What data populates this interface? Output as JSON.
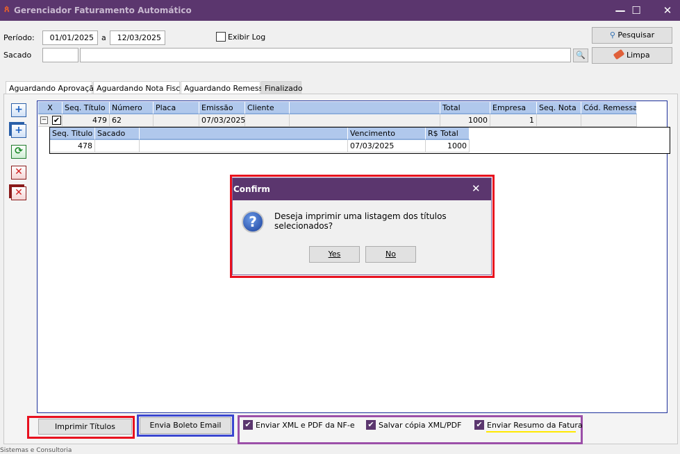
{
  "window": {
    "title": "Gerenciador Faturamento Automático",
    "minimize": "—",
    "maximize": "☐",
    "close": "✕"
  },
  "filters": {
    "periodo_label": "Período:",
    "date_from": "01/01/2025",
    "date_sep": "a",
    "date_to": "12/03/2025",
    "exibir_log_label": "Exibir Log",
    "sacado_label": "Sacado",
    "sacado_code": "",
    "sacado_name": ""
  },
  "buttons": {
    "pesquisar": "Pesquisar",
    "limpa": "Limpa",
    "imprimir": "Imprimir Títulos",
    "envia_boleto": "Envia Boleto Email"
  },
  "tabs": [
    "Aguardando Aprovação",
    "Aguardando Nota Fiscal",
    "Aguardando Remessa",
    "Finalizado"
  ],
  "grid": {
    "columns": [
      "X",
      "Seq. Título",
      "Número",
      "Placa",
      "Emissão",
      "Cliente",
      "",
      "Total",
      "Empresa",
      "Seq. Nota",
      "Cód. Remessa"
    ],
    "rows": [
      {
        "expand": "−",
        "checked": true,
        "seq": "479",
        "numero": "62",
        "placa": "",
        "emissao": "07/03/2025",
        "cliente": "",
        "blank": "",
        "total": "1000",
        "empresa": "1",
        "seq_nota": "",
        "cod_remessa": ""
      }
    ],
    "detail": {
      "columns": [
        "Seq. Titulo",
        "Sacado",
        "",
        "Vencimento",
        "R$ Total"
      ],
      "rows": [
        {
          "seq": "478",
          "sacado": "",
          "blank": "",
          "vencimento": "07/03/2025",
          "total": "1000"
        }
      ]
    }
  },
  "options": [
    {
      "label": "Enviar XML e PDF da NF-e",
      "checked": true
    },
    {
      "label": "Salvar cópia XML/PDF",
      "checked": true
    },
    {
      "label": "Enviar Resumo da Fatura",
      "checked": true
    }
  ],
  "dialog": {
    "title": "Confirm",
    "message": "Deseja imprimir uma listagem dos títulos selecionados?",
    "yes": "Yes",
    "no": "No",
    "close": "✕"
  },
  "footer": {
    "text": "Sistemas e Consultoria"
  },
  "colors": {
    "titlebar": "#5b366e",
    "grid_header": "#b0c8ec",
    "highlight_red": "#e8101e",
    "highlight_blue": "#3a46d0",
    "highlight_purple": "#9b4fa8",
    "underline_yellow": "#ffe800"
  }
}
